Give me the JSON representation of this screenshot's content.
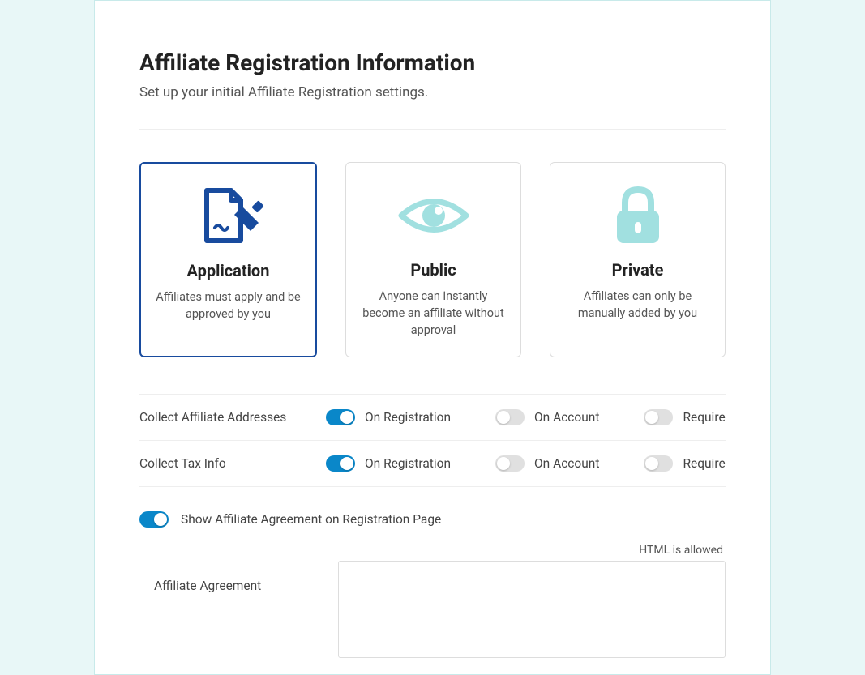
{
  "header": {
    "title": "Affiliate Registration Information",
    "subtitle": "Set up your initial Affiliate Registration settings."
  },
  "cards": [
    {
      "title": "Application",
      "desc": "Affiliates must apply and be approved by you",
      "selected": true
    },
    {
      "title": "Public",
      "desc": "Anyone can instantly become an affiliate without approval",
      "selected": false
    },
    {
      "title": "Private",
      "desc": "Affiliates can only be manually added by you",
      "selected": false
    }
  ],
  "settings": {
    "collect_addresses": {
      "label": "Collect Affiliate Addresses",
      "on_registration_label": "On Registration",
      "on_registration": true,
      "on_account_label": "On Account",
      "on_account": false,
      "require_label": "Require",
      "require": false
    },
    "collect_tax": {
      "label": "Collect Tax Info",
      "on_registration_label": "On Registration",
      "on_registration": true,
      "on_account_label": "On Account",
      "on_account": false,
      "require_label": "Require",
      "require": false
    },
    "show_agreement": {
      "label": "Show Affiliate Agreement on Registration Page",
      "value": true
    }
  },
  "agreement": {
    "html_note": "HTML is allowed",
    "label": "Affiliate Agreement",
    "value": ""
  }
}
